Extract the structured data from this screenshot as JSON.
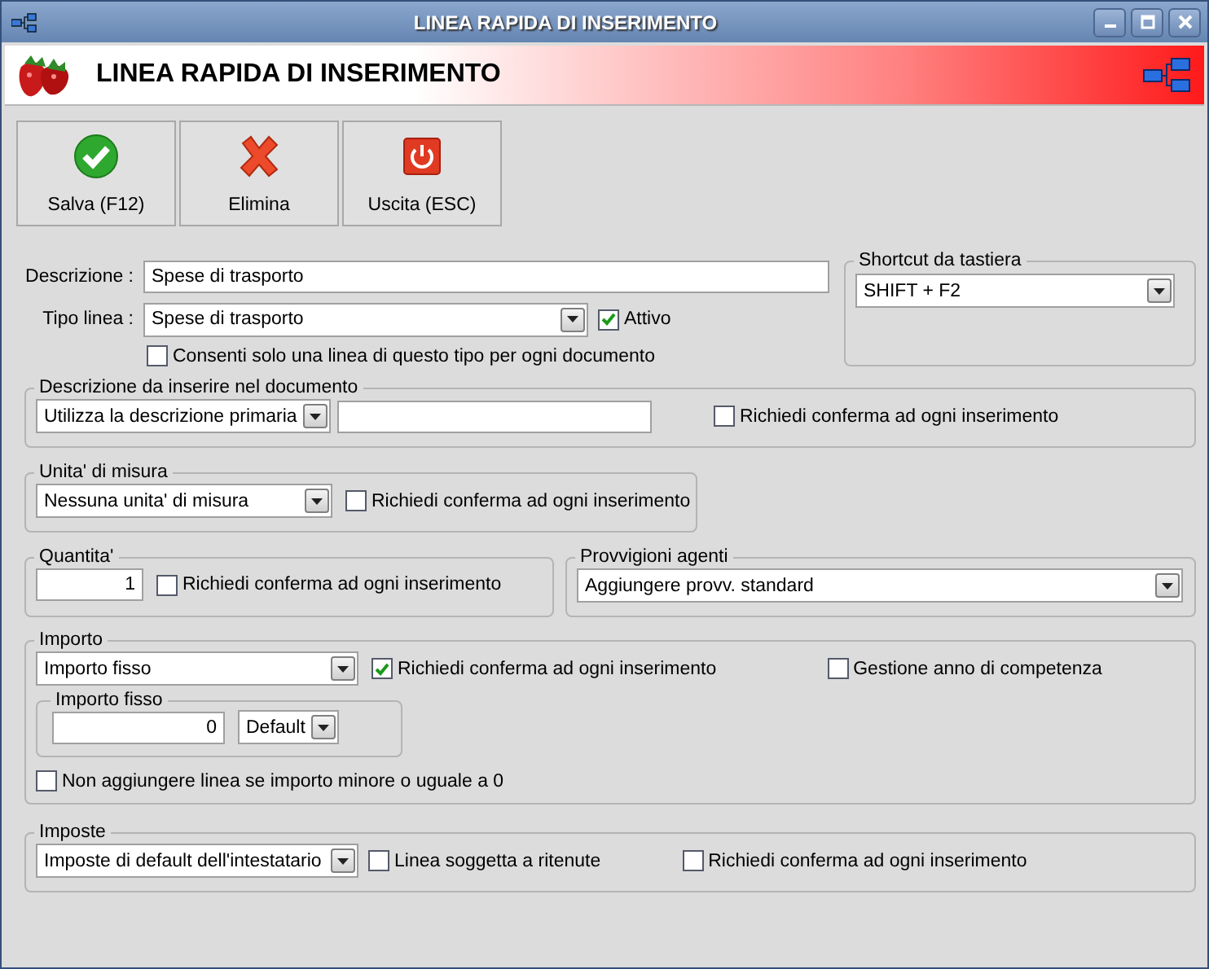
{
  "window": {
    "title": "LINEA RAPIDA DI INSERIMENTO"
  },
  "header": {
    "title": "LINEA RAPIDA DI INSERIMENTO"
  },
  "toolbar": [
    {
      "kind": "save",
      "label": "Salva (F12)"
    },
    {
      "kind": "delete",
      "label": "Elimina"
    },
    {
      "kind": "exit",
      "label": "Uscita (ESC)"
    }
  ],
  "description": {
    "label": "Descrizione :",
    "value": "Spese di trasporto"
  },
  "line_type": {
    "label": "Tipo linea :",
    "value": "Spese di trasporto",
    "active": {
      "label": "Attivo",
      "checked": true
    }
  },
  "single_per_document": {
    "label": "Consenti solo una linea di questo tipo per ogni documento",
    "checked": false
  },
  "shortcut": {
    "title": "Shortcut da tastiera",
    "value": "SHIFT + F2"
  },
  "document_description": {
    "title": "Descrizione da inserire nel documento",
    "mode": "Utilizza la descrizione primaria",
    "confirm": {
      "label": "Richiedi conferma ad ogni inserimento",
      "checked": false
    }
  },
  "unit": {
    "title": "Unita' di misura",
    "value": "Nessuna unita' di misura",
    "confirm": {
      "label": "Richiedi conferma ad ogni inserimento",
      "checked": false
    }
  },
  "quantity": {
    "title": "Quantita'",
    "value": "1",
    "confirm": {
      "label": "Richiedi conferma ad ogni inserimento",
      "checked": false
    }
  },
  "commissions": {
    "title": "Provvigioni agenti",
    "value": "Aggiungere provv. standard"
  },
  "amount": {
    "title": "Importo",
    "mode": "Importo fisso",
    "confirm": {
      "label": "Richiedi conferma ad ogni inserimento",
      "checked": true
    },
    "competence_year": {
      "label": "Gestione anno di competenza",
      "checked": false
    },
    "fixed": {
      "title": "Importo fisso",
      "value": "0",
      "option": "Default"
    },
    "skip_if_zero": {
      "label": "Non aggiungere linea se importo minore o uguale a 0",
      "checked": false
    }
  },
  "taxes": {
    "title": "Imposte",
    "value": "Imposte di default dell'intestatario",
    "withholding": {
      "label": "Linea soggetta a ritenute",
      "checked": false
    },
    "confirm": {
      "label": "Richiedi conferma ad ogni inserimento",
      "checked": false
    }
  }
}
